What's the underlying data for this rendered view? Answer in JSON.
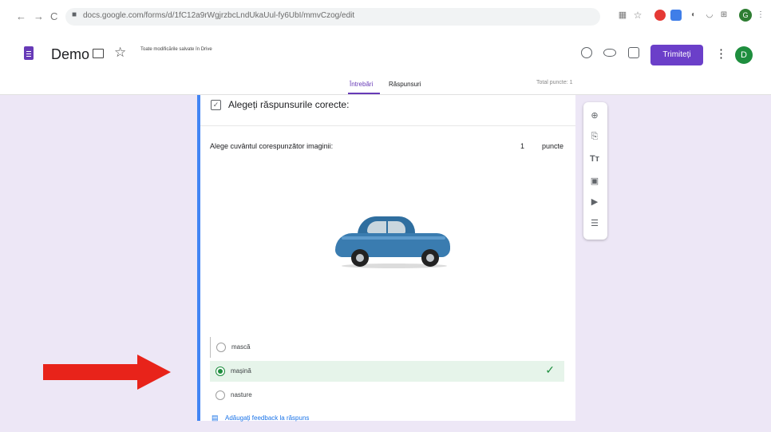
{
  "browser": {
    "back": "←",
    "forward": "→",
    "reload": "C",
    "url": "docs.google.com/forms/d/1fC12a9rWgjrzbcLndUkaUul-fy6UbI/mmvCzog/edit",
    "extensions": [
      "red-extension",
      "blue-extension"
    ],
    "avatar_letter": "G",
    "menu": "⋮"
  },
  "header": {
    "title": "Demo",
    "save_status": "Toate modificările salvate în Drive",
    "send_label": "Trimiteți",
    "avatar_letter": "D",
    "icons": [
      "palette-icon",
      "eye-icon",
      "settings-icon",
      "more-icon"
    ]
  },
  "tabs": {
    "questions": "Întrebări",
    "responses": "Răspunsuri",
    "total_points": "Total puncte: 1"
  },
  "question": {
    "answer_key_title": "Alegeți răspunsurile corecte:",
    "text": "Alege cuvântul corespunzător imaginii:",
    "points_value": "1",
    "points_label": "puncte",
    "image": "car-image",
    "options": [
      {
        "label": "mască",
        "correct": false
      },
      {
        "label": "mașină",
        "correct": true
      },
      {
        "label": "nasture",
        "correct": false
      }
    ],
    "feedback_link": "Adăugați feedback la răspuns"
  },
  "toolbar": {
    "items": [
      "add-question-icon",
      "import-questions-icon",
      "add-title-icon",
      "add-image-icon",
      "add-video-icon",
      "add-section-icon"
    ]
  },
  "colors": {
    "accent": "#673ab7",
    "send_button": "#6b3fc9",
    "canvas": "#ede7f6",
    "card_highlight": "#4285f4",
    "correct": "#1e8e3e",
    "correct_bg": "#e6f4ea",
    "arrow": "#e8231a"
  }
}
